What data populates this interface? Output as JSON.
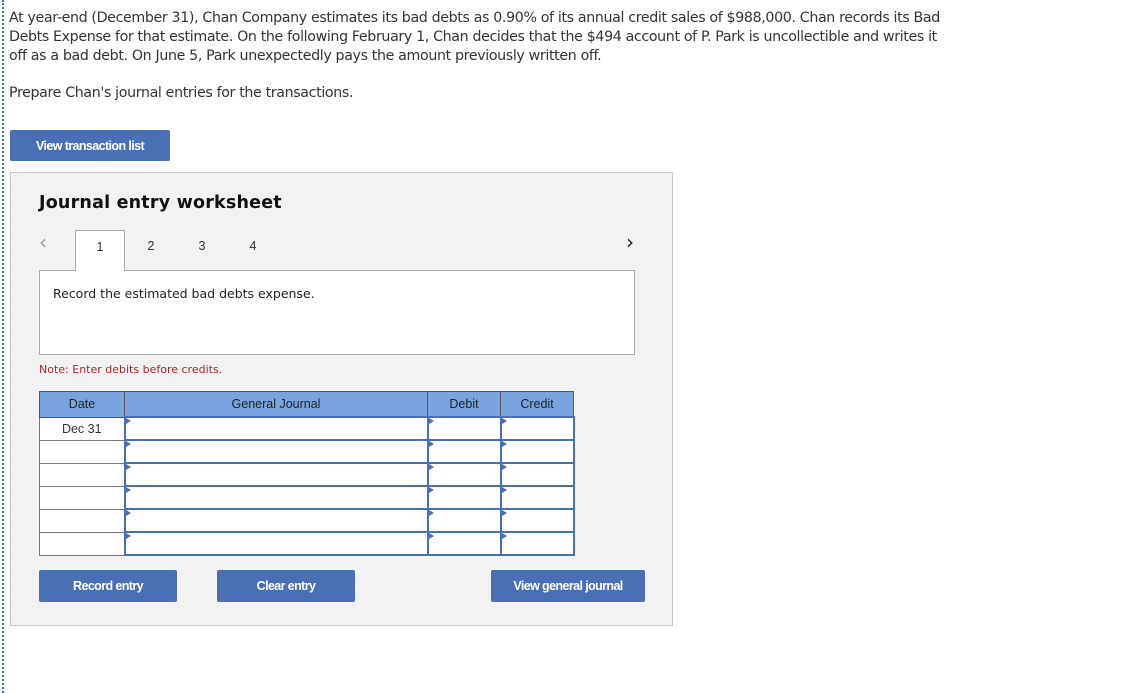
{
  "question": {
    "paragraph": "At year-end (December 31), Chan Company estimates its bad debts as 0.90% of its annual credit sales of $988,000. Chan records its Bad Debts Expense for that estimate. On the following February 1, Chan decides that the $494 account of P. Park is uncollectible and writes it off as a bad debt. On June 5, Park unexpectedly pays the amount previously written off.",
    "instruction": "Prepare Chan's journal entries for the transactions."
  },
  "buttons": {
    "view_transaction_list": "View transaction list",
    "record_entry": "Record entry",
    "clear_entry": "Clear entry",
    "view_general_journal": "View general journal"
  },
  "worksheet": {
    "title": "Journal entry worksheet",
    "prev_icon": "‹",
    "next_icon": "›",
    "tabs": [
      {
        "label": "1",
        "active": true
      },
      {
        "label": "2",
        "active": false
      },
      {
        "label": "3",
        "active": false
      },
      {
        "label": "4",
        "active": false
      }
    ],
    "description": "Record the estimated bad debts expense.",
    "note": "Note: Enter debits before credits."
  },
  "table": {
    "headers": {
      "date": "Date",
      "journal": "General Journal",
      "debit": "Debit",
      "credit": "Credit"
    },
    "rows": [
      {
        "date": "Dec 31",
        "account": "",
        "debit": "",
        "credit": ""
      },
      {
        "date": "",
        "account": "",
        "debit": "",
        "credit": ""
      },
      {
        "date": "",
        "account": "",
        "debit": "",
        "credit": ""
      },
      {
        "date": "",
        "account": "",
        "debit": "",
        "credit": ""
      },
      {
        "date": "",
        "account": "",
        "debit": "",
        "credit": ""
      },
      {
        "date": "",
        "account": "",
        "debit": "",
        "credit": ""
      }
    ]
  },
  "colors": {
    "button_blue": "#4a6fb5",
    "header_blue": "#7aa4e0",
    "note_red": "#a7292b",
    "panel_gray": "#f2f2f2"
  }
}
